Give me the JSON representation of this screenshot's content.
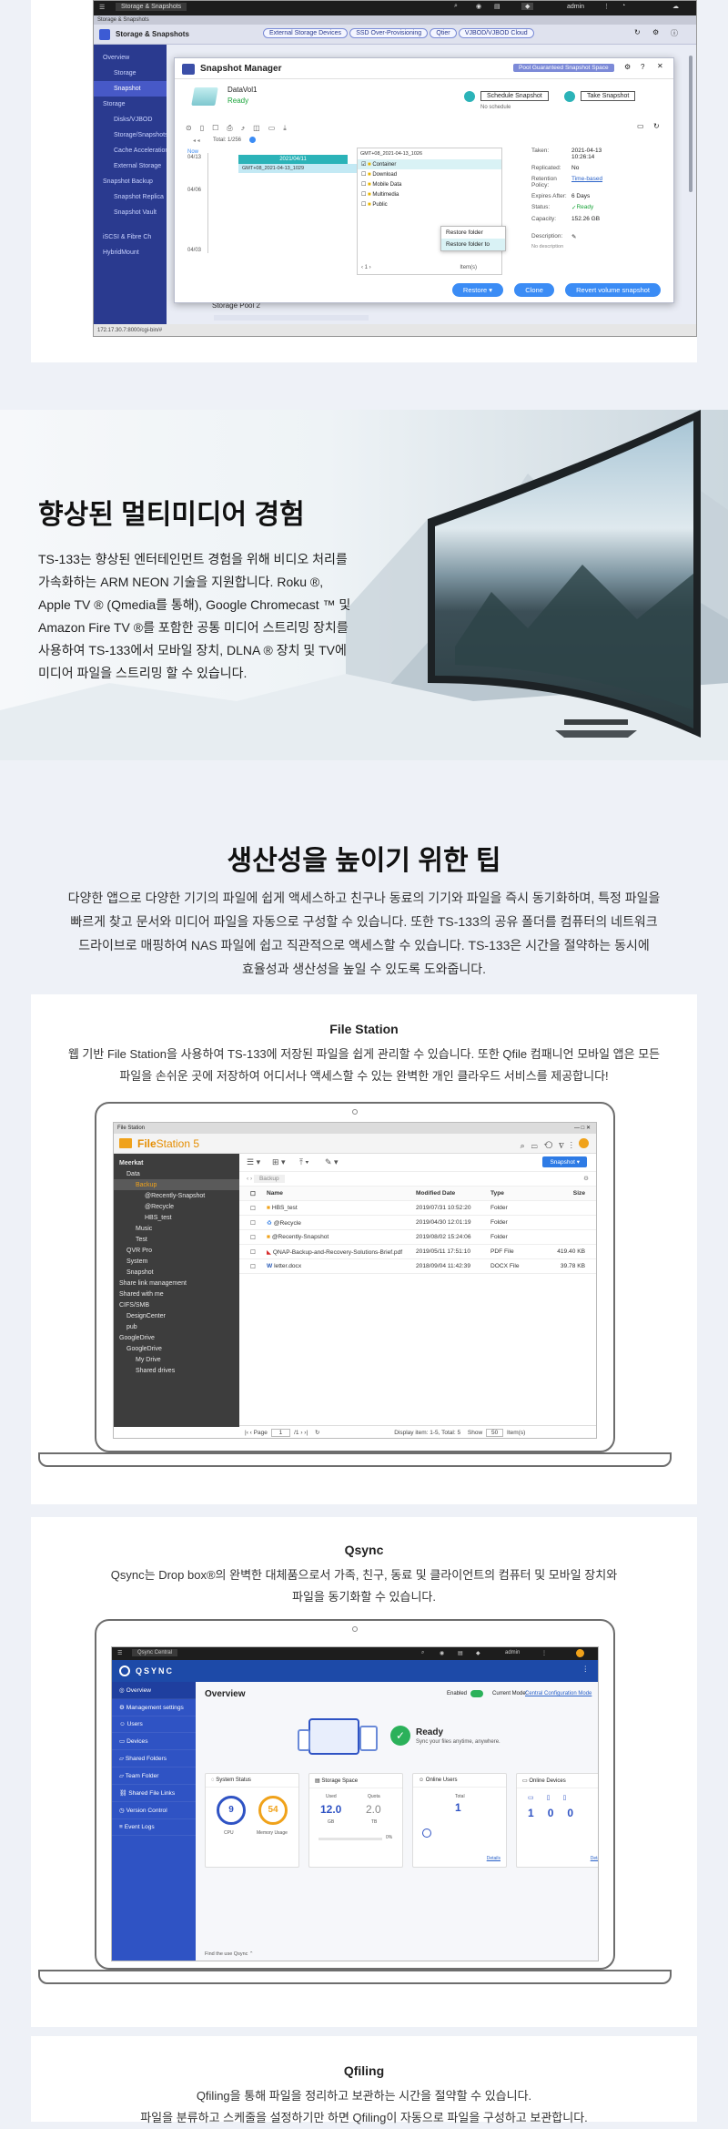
{
  "snapshot_screen": {
    "topbar": {
      "tab": "Storage & Snapshots",
      "user": "admin"
    },
    "app_bar_small": "Storage & Snapshots",
    "app_title": "Storage & Snapshots",
    "toolbar_pills": [
      "External Storage Devices",
      "SSD Over-Provisioning",
      "Qtier",
      "VJBOD/VJBOD Cloud"
    ],
    "sidebar": [
      "Overview",
      "Storage",
      "Snapshot",
      "Storage",
      "Disks/VJBOD",
      "Storage/Snapshots",
      "Cache Acceleration",
      "External Storage",
      "Snapshot Backup",
      "Snapshot Replica",
      "Snapshot Vault",
      "iSCSI & Fibre Ch",
      "HybridMount"
    ],
    "dialog": {
      "title": "Snapshot Manager",
      "pool_pill": "Pool Guaranteed Snapshot Space",
      "volume": "DataVol1",
      "status": "Ready",
      "schedule_btn": "Schedule Snapshot",
      "schedule_sub": "No schedule",
      "take_btn": "Take Snapshot",
      "total": "Total: 1/256",
      "times": [
        "Now",
        "04/13",
        "04/06",
        "04/03"
      ],
      "snap_date": "2021/04/11",
      "snap_name": "GMT+08_2021-04-13_1029",
      "path": "GMT+08_2021-04-13_1026",
      "folders": [
        "Container",
        "Download",
        "Mobile Data",
        "Multimedia",
        "Public"
      ],
      "ctx_menu": [
        "Restore folder",
        "Restore folder to"
      ],
      "pager": "1",
      "items": "Item(s)",
      "info": [
        {
          "k": "Taken:",
          "v": "2021-04-13 10:26:14"
        },
        {
          "k": "Replicated:",
          "v": "No"
        },
        {
          "k": "Retention Policy:",
          "v": "Time-based"
        },
        {
          "k": "Expires After:",
          "v": "6 Days"
        },
        {
          "k": "Status:",
          "v": "Ready"
        },
        {
          "k": "Capacity:",
          "v": "152.26 GB"
        },
        {
          "k": "Description:",
          "v": ""
        }
      ],
      "no_desc": "No description",
      "restore_btn": "Restore",
      "clone_btn": "Clone",
      "revert_btn": "Revert volume snapshot"
    },
    "pool_label": "Storage Pool 2",
    "statusbar": "172.17.30.7:8000/cgi-bin/#"
  },
  "tv": {
    "heading": "향상된 멀티미디어 경험",
    "body": [
      "TS-133는 향상된 엔터테인먼트 경험을 위해 비디오 처리를",
      "가속화하는 ARM NEON 기술을 지원합니다. Roku ®,",
      "Apple TV ® (Qmedia를 통해), Google Chromecast ™ 및",
      "Amazon Fire TV ®를 포함한 공통 미디어 스트리밍 장치를",
      "사용하여 TS-133에서 모바일 장치, DLNA ® 장치 및 TV에",
      "미디어 파일을 스트리밍 할 수 있습니다."
    ]
  },
  "tips": {
    "heading": "생산성을 높이기 위한 팁",
    "body": [
      "다양한 앱으로 다양한 기기의 파일에 쉽게 액세스하고 친구나 동료의 기기와 파일을 즉시 동기화하며, 특정 파일을",
      "빠르게 찾고 문서와 미디어 파일을 자동으로 구성할 수 있습니다. 또한 TS-133의 공유 폴더를 컴퓨터의 네트워크",
      "드라이브로 매핑하여 NAS 파일에 쉽고 직관적으로 액세스할 수 있습니다. TS-133은 시간을 절약하는 동시에",
      "효율성과 생산성을 높일 수 있도록 도와줍니다."
    ]
  },
  "filestation": {
    "title": "File Station",
    "desc": [
      "웹 기반 File Station을 사용하여 TS-133에 저장된 파일을 쉽게 관리할 수 있습니다. 또한 Qfile 컴패니언 모바일 앱은 모든",
      "파일을 손쉬운 곳에 저장하여 어디서나 액세스할 수 있는 완벽한 개인 클라우드 서비스를 제공합니다!"
    ],
    "screen": {
      "window_title": "File Station",
      "brand_a": "File",
      "brand_b": "Station 5",
      "snapshot_btn": "Snapshot",
      "breadcrumb": "Backup",
      "tree": [
        "Meerkat",
        "Data",
        "Backup",
        "@Recently-Snapshot",
        "@Recycle",
        "HBS_test",
        "Music",
        "Test",
        "QVR Pro",
        "System",
        "Snapshot",
        "Share link management",
        "Shared with me",
        "CIFS/SMB",
        "DesignCenter",
        "pub",
        "GoogleDrive",
        "GoogleDrive",
        "My Drive",
        "Shared drives"
      ],
      "cols": [
        "Name",
        "Modified Date",
        "Type",
        "Size"
      ],
      "rows": [
        [
          "HBS_test",
          "2019/07/31 10:52:20",
          "Folder",
          ""
        ],
        [
          "@Recycle",
          "2019/04/30 12:01:19",
          "Folder",
          ""
        ],
        [
          "@Recently-Snapshot",
          "2019/08/02 15:24:06",
          "Folder",
          ""
        ],
        [
          "QNAP-Backup-and-Recovery-Solutions-Brief.pdf",
          "2019/05/11 17:51:10",
          "PDF File",
          "419.40 KB"
        ],
        [
          "letter.docx",
          "2018/09/04 11:42:39",
          "DOCX File",
          "39.78 KB"
        ]
      ],
      "page_label": "Page",
      "page_num": "1",
      "page_of": "/1",
      "display": "Display item: 1-5, Total: 5",
      "show": "Show",
      "show_num": "50",
      "items": "Item(s)"
    }
  },
  "qsync": {
    "title": "Qsync",
    "desc": [
      "Qsync는 Drop box®의 완벽한 대체품으로서 가족, 친구, 동료 및 클라이언트의 컴퓨터 및 모바일 장치와",
      "파일을 동기화할 수 있습니다."
    ],
    "screen": {
      "tab": "Qsync Central",
      "user": "admin",
      "brand": "QSYNC",
      "nav": [
        "Overview",
        "Management settings",
        "Users",
        "Devices",
        "Shared Folders",
        "Team Folder",
        "Shared File Links",
        "Version Control",
        "Event Logs"
      ],
      "page_title": "Overview",
      "enabled": "Enabled",
      "mode_label": "Current Mode:",
      "mode_value": "Central Configuration Mode",
      "ready": "Ready",
      "ready_sub": "Sync your files anytime, anywhere.",
      "box_titles": [
        "System Status",
        "Storage Space",
        "Online Users",
        "Online Devices"
      ],
      "cpu": "9",
      "cpu_label": "CPU",
      "mem": "54",
      "mem_label": "Memory Usage",
      "used_label": "Used",
      "used": "12.0",
      "used_unit": "GB",
      "total_label": "Quota",
      "total": "2.0",
      "total_unit": "TB",
      "pct": "0%",
      "online_label": "Total",
      "online": "1",
      "devices": [
        "1",
        "0",
        "0"
      ],
      "details": "Details",
      "footer": "Find the use Qsync"
    }
  },
  "qfiling": {
    "title": "Qfiling",
    "desc": [
      "Qfiling을 통해 파일을 정리하고 보관하는 시간을 절약할 수 있습니다.",
      "파일을 분류하고 스케줄을 설정하기만 하면 Qfiling이 자동으로 파일을 구성하고 보관합니다."
    ]
  }
}
